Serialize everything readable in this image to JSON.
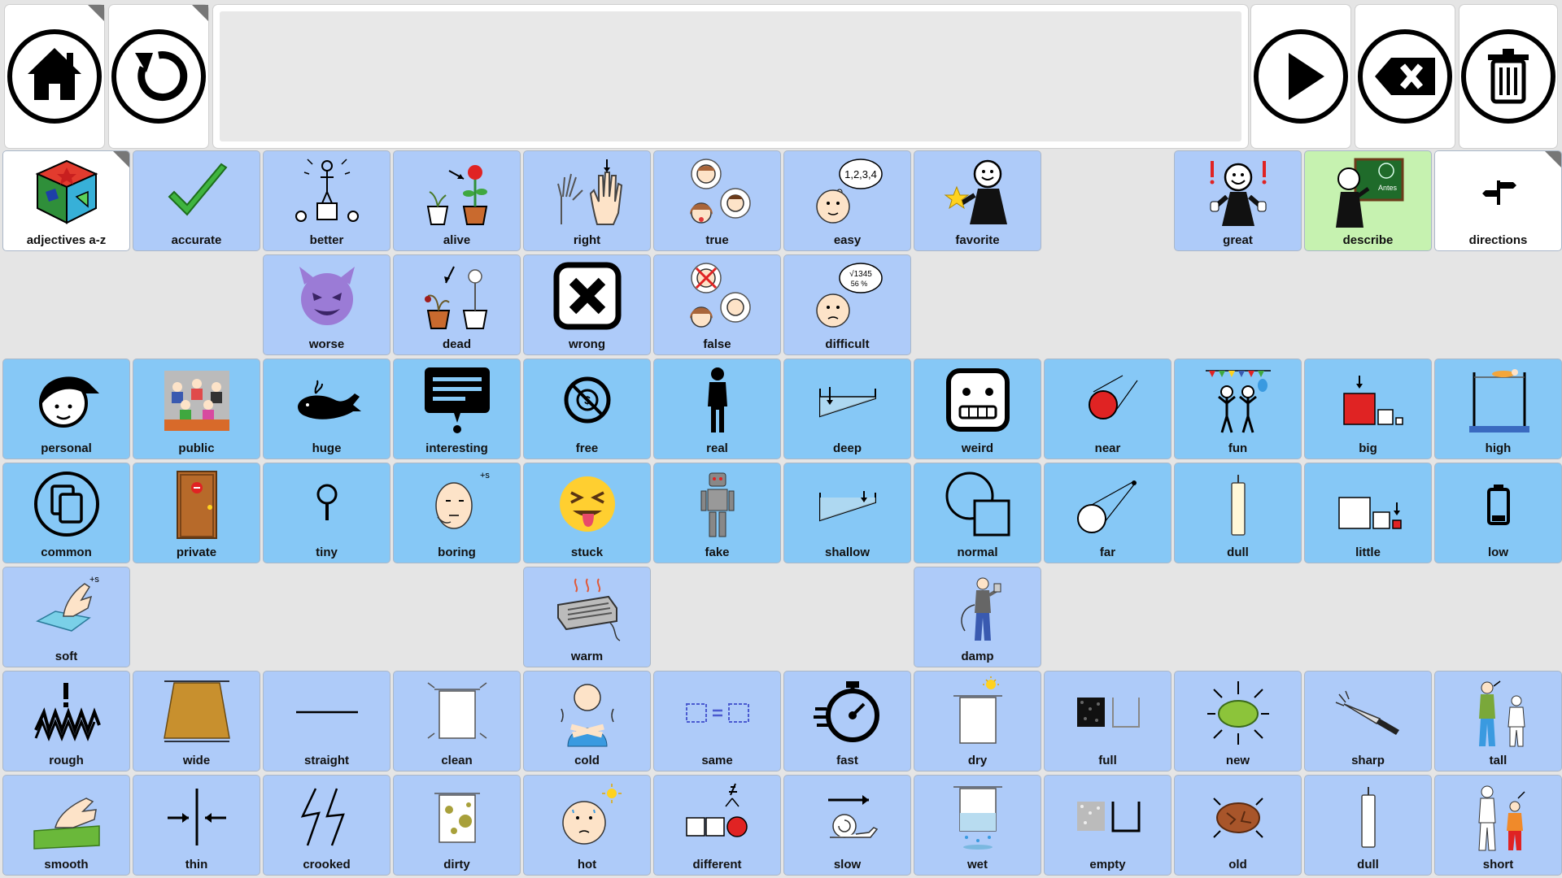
{
  "toolbar": {
    "home_icon": "home-icon",
    "back_icon": "undo-icon",
    "speak_icon": "play-icon",
    "delete_icon": "backspace-icon",
    "clear_icon": "trash-icon",
    "message_text": ""
  },
  "colors": {
    "core_tile": "#aecbf9",
    "adjective_tile": "#86c8f6",
    "folder_tile": "#ffffff",
    "highlight_tile": "#c6f2b0",
    "background": "#e5e5e5"
  },
  "row1": [
    "adjectives a-z",
    "accurate",
    "better",
    "alive",
    "right",
    "true",
    "easy",
    "favorite",
    "great",
    "describe",
    "directions"
  ],
  "row2": [
    "worse",
    "dead",
    "wrong",
    "false",
    "difficult"
  ],
  "row3": [
    "personal",
    "public",
    "huge",
    "interesting",
    "free",
    "real",
    "deep",
    "weird",
    "near",
    "fun",
    "big",
    "high"
  ],
  "row4": [
    "common",
    "private",
    "tiny",
    "boring",
    "stuck",
    "fake",
    "shallow",
    "normal",
    "far",
    "dull",
    "little",
    "low"
  ],
  "row5": [
    "soft",
    "warm",
    "damp"
  ],
  "row6": [
    "rough",
    "wide",
    "straight",
    "clean",
    "cold",
    "same",
    "fast",
    "dry",
    "full",
    "new",
    "sharp",
    "tall"
  ],
  "row7": [
    "smooth",
    "thin",
    "crooked",
    "dirty",
    "hot",
    "different",
    "slow",
    "wet",
    "empty",
    "old",
    "dull",
    "short"
  ],
  "symbol_text": {
    "easy": "1,2,3,4",
    "difficult": "√1345",
    "difficult_2": "56 %",
    "describe": "Antes"
  }
}
